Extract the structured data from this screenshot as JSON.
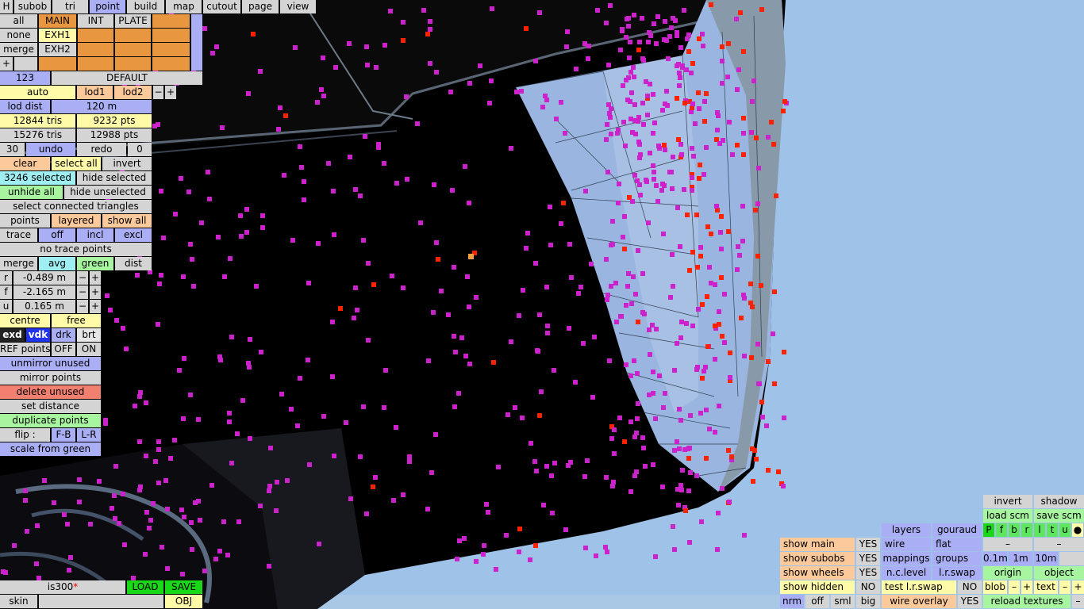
{
  "menu": {
    "h": "H",
    "tabs": [
      "subob",
      "tri",
      "point",
      "build",
      "map",
      "cutout",
      "page",
      "view"
    ],
    "active_tab": "point"
  },
  "layers": {
    "all": "all",
    "none": "none",
    "merge": "merge",
    "plus": "+",
    "main": "MAIN",
    "int": "INT",
    "plate": "PLATE",
    "exh1": "EXH1",
    "exh2": "EXH2",
    "num": "123",
    "default": "DEFAULT"
  },
  "lod": {
    "auto": "auto",
    "lod1": "lod1",
    "lod2": "lod2",
    "minus": "−",
    "plus": "+",
    "dist_label": "lod dist",
    "dist_value": "120 m"
  },
  "stats": {
    "tris1": "12844 tris",
    "pts1": "9232 pts",
    "tris2": "15276 tris",
    "pts2": "12988 pts"
  },
  "undo": {
    "count": "30",
    "undo": "undo",
    "redo": "redo",
    "redo_count": "0"
  },
  "selection": {
    "clear": "clear",
    "select_all": "select all",
    "invert": "invert",
    "selected": "3246 selected",
    "hide_selected": "hide selected",
    "unhide_all": "unhide all",
    "hide_unselected": "hide unselected",
    "select_connected": "select connected triangles",
    "points": "points",
    "layered": "layered",
    "show_all": "show all"
  },
  "trace": {
    "trace": "trace",
    "off": "off",
    "incl": "incl",
    "excl": "excl",
    "no_trace": "no trace points"
  },
  "merge_row": {
    "merge": "merge",
    "avg": "avg",
    "green": "green",
    "dist": "dist"
  },
  "coords": [
    {
      "axis": "r",
      "value": "-0.489 m"
    },
    {
      "axis": "f",
      "value": "-2.165 m"
    },
    {
      "axis": "u",
      "value": "0.165 m"
    }
  ],
  "pivot": {
    "centre": "centre",
    "free": "free"
  },
  "display_modes": {
    "exd": "exd",
    "vdk": "vdk",
    "drk": "drk",
    "brt": "brt"
  },
  "ref": {
    "label": "REF points",
    "off": "OFF",
    "on": "ON"
  },
  "actions": {
    "unmirror": "unmirror unused",
    "mirror": "mirror points",
    "delete_unused": "delete unused",
    "set_distance": "set distance",
    "duplicate": "duplicate points",
    "flip_label": "flip :",
    "fb": "F-B",
    "lr": "L-R",
    "scale_green": "scale from green"
  },
  "file": {
    "name": "is300",
    "modified_mark": "*",
    "load": "LOAD",
    "save": "SAVE",
    "skin": "skin",
    "obj": "OBJ"
  },
  "view_panel": {
    "invert": "invert",
    "shadow": "shadow",
    "load_scm": "load scm",
    "save_scm": "save scm",
    "letters": [
      "P",
      "f",
      "b",
      "r",
      "l",
      "t",
      "u",
      "●"
    ],
    "layers": "layers",
    "gouraud": "gouraud",
    "wire": "wire",
    "flat": "flat",
    "dash": "–",
    "mappings": "mappings",
    "groups": "groups",
    "d01": "0.1m",
    "d1": "1m",
    "d10": "10m",
    "nclevel": "n.c.level",
    "lrswap": "l.r.swap",
    "origin": "origin",
    "object": "object",
    "test_lrswap": "test l.r.swap",
    "no": "NO",
    "blob": "blob",
    "text": "text",
    "minus": "–",
    "plus": "+",
    "show_main": "show main",
    "show_subobs": "show subobs",
    "show_wheels": "show wheels",
    "show_hidden": "show hidden",
    "yes": "YES",
    "nrm": "nrm",
    "off": "off",
    "sml": "sml",
    "big": "big",
    "wire_overlay": "wire overlay",
    "reload_textures": "reload textures"
  },
  "colors": {
    "sky": "#9ec2e8",
    "mesh": "#000000",
    "point": "#cc22cc",
    "point_sel": "#ff2200",
    "panel_blue": "#a9aef5"
  }
}
